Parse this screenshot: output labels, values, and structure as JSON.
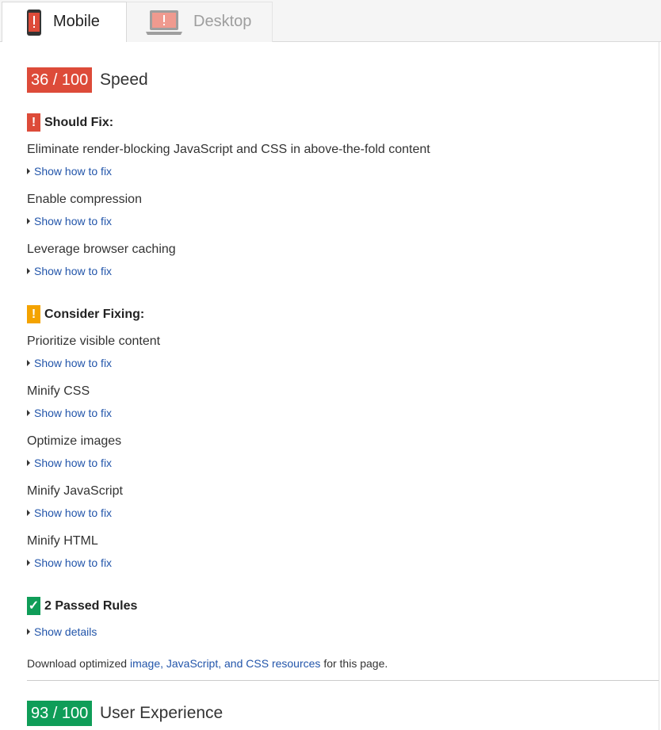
{
  "tabs": {
    "mobile": "Mobile",
    "desktop": "Desktop"
  },
  "speed": {
    "score": "36 / 100",
    "label": "Speed",
    "score_color": "#dd4b39"
  },
  "should_fix": {
    "title": "Should Fix:",
    "icon": "!",
    "color": "#dd4b39",
    "rules": [
      {
        "title": "Eliminate render-blocking JavaScript and CSS in above-the-fold content",
        "link": "Show how to fix"
      },
      {
        "title": "Enable compression",
        "link": "Show how to fix"
      },
      {
        "title": "Leverage browser caching",
        "link": "Show how to fix"
      }
    ]
  },
  "consider_fixing": {
    "title": "Consider Fixing:",
    "icon": "!",
    "color": "#f4a300",
    "rules": [
      {
        "title": "Prioritize visible content",
        "link": "Show how to fix"
      },
      {
        "title": "Minify CSS",
        "link": "Show how to fix"
      },
      {
        "title": "Optimize images",
        "link": "Show how to fix"
      },
      {
        "title": "Minify JavaScript",
        "link": "Show how to fix"
      },
      {
        "title": "Minify HTML",
        "link": "Show how to fix"
      }
    ]
  },
  "passed": {
    "title": "2 Passed Rules",
    "icon": "✓",
    "color": "#0f9d58",
    "link": "Show details"
  },
  "download": {
    "prefix": "Download optimized",
    "link": "image, JavaScript, and CSS resources",
    "suffix": "for this page."
  },
  "user_experience": {
    "score": "93 / 100",
    "label": "User Experience",
    "score_color": "#0f9d58"
  }
}
